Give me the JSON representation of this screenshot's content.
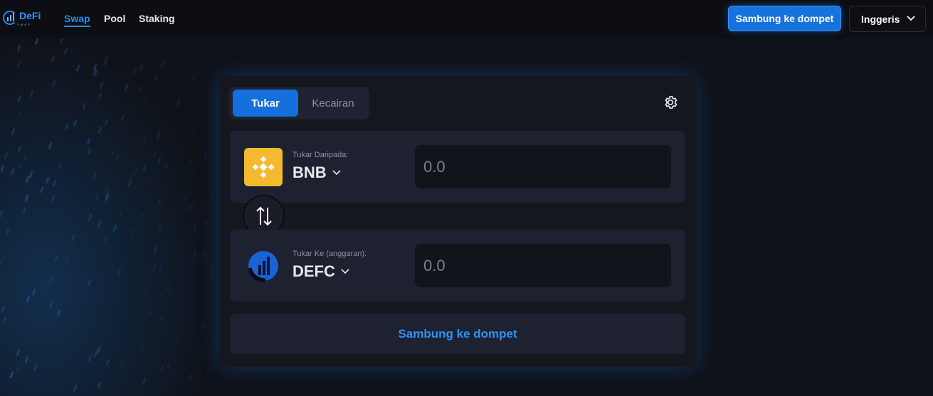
{
  "brand": {
    "name": "DeFi",
    "sub": "SWAP",
    "accent": "#1d8cf0"
  },
  "nav": {
    "swap": "Swap",
    "pool": "Pool",
    "staking": "Staking"
  },
  "header": {
    "connect_label": "Sambung ke dompet",
    "language_label": "Inggeris"
  },
  "tabs": {
    "swap_label": "Tukar",
    "liquidity_label": "Kecairan"
  },
  "from": {
    "label": "Tukar Daripada:",
    "token": "BNB",
    "placeholder": "0.0",
    "icon": "bnb-logo-icon"
  },
  "to": {
    "label": "Tukar Ke (anggaran):",
    "token": "DEFC",
    "placeholder": "0.0",
    "icon": "defc-logo-icon"
  },
  "main": {
    "connect_label": "Sambung ke dompet"
  },
  "colors": {
    "primary": "#1673de",
    "bnb_yellow": "#f3ba2f",
    "card_bg": "#15171f"
  }
}
